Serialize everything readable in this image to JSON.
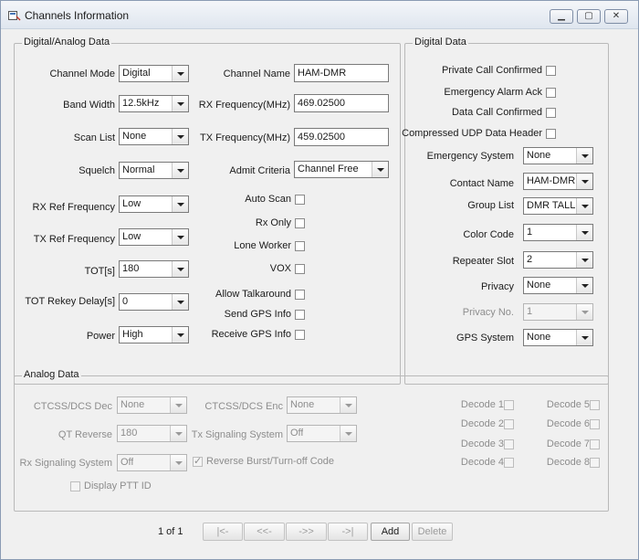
{
  "window": {
    "title": "Channels Information"
  },
  "digital_analog": {
    "legend": "Digital/Analog Data",
    "channel_mode": {
      "label": "Channel Mode",
      "value": "Digital"
    },
    "band_width": {
      "label": "Band Width",
      "value": "12.5kHz"
    },
    "scan_list": {
      "label": "Scan List",
      "value": "None"
    },
    "squelch": {
      "label": "Squelch",
      "value": "Normal"
    },
    "rx_ref_frequency": {
      "label": "RX Ref Frequency",
      "value": "Low"
    },
    "tx_ref_frequency": {
      "label": "TX Ref Frequency",
      "value": "Low"
    },
    "tot": {
      "label": "TOT[s]",
      "value": "180"
    },
    "tot_rekey_delay": {
      "label": "TOT Rekey Delay[s]",
      "value": "0"
    },
    "power": {
      "label": "Power",
      "value": "High"
    },
    "channel_name": {
      "label": "Channel Name",
      "value": "HAM-DMR"
    },
    "rx_frequency": {
      "label": "RX Frequency(MHz)",
      "value": "469.02500"
    },
    "tx_frequency": {
      "label": "TX Frequency(MHz)",
      "value": "459.02500"
    },
    "admit_criteria": {
      "label": "Admit Criteria",
      "value": "Channel Free"
    },
    "auto_scan": {
      "label": "Auto Scan"
    },
    "rx_only": {
      "label": "Rx Only"
    },
    "lone_worker": {
      "label": "Lone Worker"
    },
    "vox": {
      "label": "VOX"
    },
    "allow_talkaround": {
      "label": "Allow Talkaround"
    },
    "send_gps_info": {
      "label": "Send GPS Info"
    },
    "receive_gps_info": {
      "label": "Receive GPS Info"
    }
  },
  "digital": {
    "legend": "Digital Data",
    "private_call_confirmed": {
      "label": "Private Call Confirmed"
    },
    "emergency_alarm_ack": {
      "label": "Emergency Alarm Ack"
    },
    "data_call_confirmed": {
      "label": "Data Call Confirmed"
    },
    "compressed_udp": {
      "label": "Compressed UDP Data Header"
    },
    "emergency_system": {
      "label": "Emergency System",
      "value": "None"
    },
    "contact_name": {
      "label": "Contact Name",
      "value": "HAM-DMR"
    },
    "group_list": {
      "label": "Group List",
      "value": "DMR TALLIN"
    },
    "color_code": {
      "label": "Color Code",
      "value": "1"
    },
    "repeater_slot": {
      "label": "Repeater Slot",
      "value": "2"
    },
    "privacy": {
      "label": "Privacy",
      "value": "None"
    },
    "privacy_no": {
      "label": "Privacy No.",
      "value": "1"
    },
    "gps_system": {
      "label": "GPS System",
      "value": "None"
    }
  },
  "analog": {
    "legend": "Analog Data",
    "ctcss_dec": {
      "label": "CTCSS/DCS Dec",
      "value": "None"
    },
    "ctcss_enc": {
      "label": "CTCSS/DCS Enc",
      "value": "None"
    },
    "qt_reverse": {
      "label": "QT Reverse",
      "value": "180"
    },
    "tx_signaling": {
      "label": "Tx Signaling System",
      "value": "Off"
    },
    "rx_signaling": {
      "label": "Rx Signaling System",
      "value": "Off"
    },
    "reverse_burst": {
      "label": "Reverse Burst/Turn-off Code"
    },
    "display_ptt_id": {
      "label": "Display PTT ID"
    },
    "decodes": [
      "Decode 1",
      "Decode 2",
      "Decode 3",
      "Decode 4",
      "Decode 5",
      "Decode 6",
      "Decode 7",
      "Decode 8"
    ]
  },
  "pager": {
    "position": "1 of 1",
    "first": "|<-",
    "prev": "<<-",
    "next": "->>",
    "last": "->|",
    "add": "Add",
    "delete": "Delete"
  }
}
